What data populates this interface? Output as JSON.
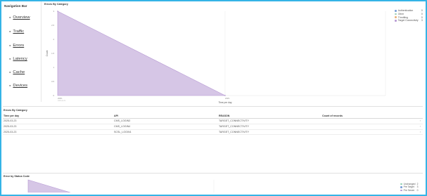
{
  "nav": {
    "title": "Navigation Bar",
    "items": [
      "Overview",
      "Traffic",
      "Errors",
      "Latency",
      "Cache",
      "Devices"
    ]
  },
  "chart1": {
    "title": "Errors By Category",
    "ylabel": "Count",
    "xlabel": "Time per day",
    "x_tick_start": "2025-",
    "x_tick_start_sub": "2025-03-23",
    "x_tick_end": "2025-",
    "legend": [
      {
        "label": "Authentication",
        "count": "0",
        "color": "#7b9fd6"
      },
      {
        "label": "Other",
        "count": "0",
        "color": "#9fd0b4"
      },
      {
        "label": "Throttling",
        "count": "0",
        "color": "#e8b17a"
      },
      {
        "label": "Target Connectivity",
        "count": "3",
        "color": "#b79ad4"
      }
    ]
  },
  "chart_data": [
    {
      "type": "area",
      "title": "Errors By Category",
      "xlabel": "Time per day",
      "ylabel": "Count",
      "x": [
        "start",
        "end"
      ],
      "series": [
        {
          "name": "Target Connectivity",
          "values": [
            3,
            0
          ]
        }
      ],
      "ylim": [
        0,
        3
      ],
      "y_ticks": [
        "0",
        "0.5",
        "1",
        "1.5",
        "2",
        "2.5",
        "3"
      ],
      "legend_position": "top-right",
      "grid": true
    },
    {
      "type": "area",
      "title": "Error by Status Code",
      "x": [
        "start",
        "end"
      ],
      "series": [
        {
          "name": "Unchanged",
          "values": [
            2,
            0
          ]
        }
      ],
      "legend_position": "top-right"
    }
  ],
  "table": {
    "title": "Errors By Category",
    "columns": [
      "Time per day",
      "API",
      "REASON",
      "Count of records"
    ],
    "rows": [
      [
        "2025-03-23",
        "CMS_LOGIN3",
        "TARGET_CONNECTIVITY",
        ""
      ],
      [
        "2025-03-23",
        "CMS_LOGIN4",
        "TARGET_CONNECTIVITY",
        ""
      ],
      [
        "2025-03-23",
        "SCSL_LOGIN1",
        "TARGET_CONNECTIVITY",
        ""
      ]
    ]
  },
  "chart2": {
    "title": "Error by Status Code",
    "legend": [
      {
        "label": "Unchanged",
        "count": "2",
        "color": "#8fd0b0"
      },
      {
        "label": "Pre Target",
        "count": "3",
        "color": "#7b9fd6"
      },
      {
        "label": "Pre Server",
        "count": "0",
        "color": "#b79ad4"
      }
    ]
  },
  "icons": {
    "row_chevron": "chevron-right-icon"
  }
}
